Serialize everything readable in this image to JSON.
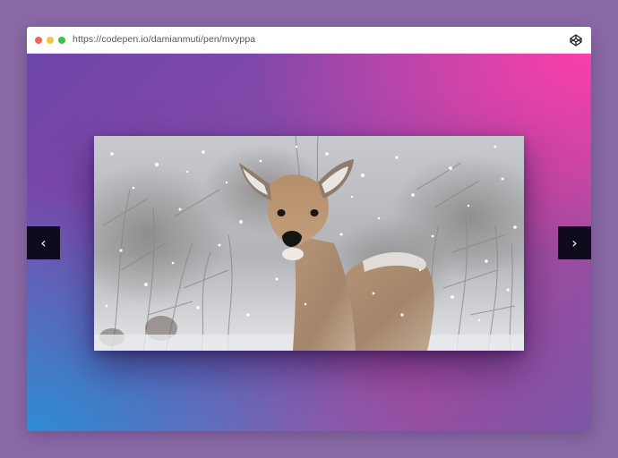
{
  "browser": {
    "url": "https://codepen.io/damianmuti/pen/mvyppa",
    "dots": [
      "#f2665a",
      "#f5c24a",
      "#3fc04b"
    ],
    "site_icon": "codepen-icon"
  },
  "slider": {
    "slide_image": "snowy-deer-photo",
    "prev_icon": "chevron-left-icon",
    "next_icon": "chevron-right-icon",
    "prev_glyph": "‹",
    "next_glyph": "›"
  },
  "colors": {
    "page_bg": "#8a6aa5",
    "gradient_pink": "#ff3eaa",
    "gradient_blue": "#2d8cd2",
    "gradient_purple": "#6d46a8",
    "nav_bg": "#0f0a1c"
  }
}
